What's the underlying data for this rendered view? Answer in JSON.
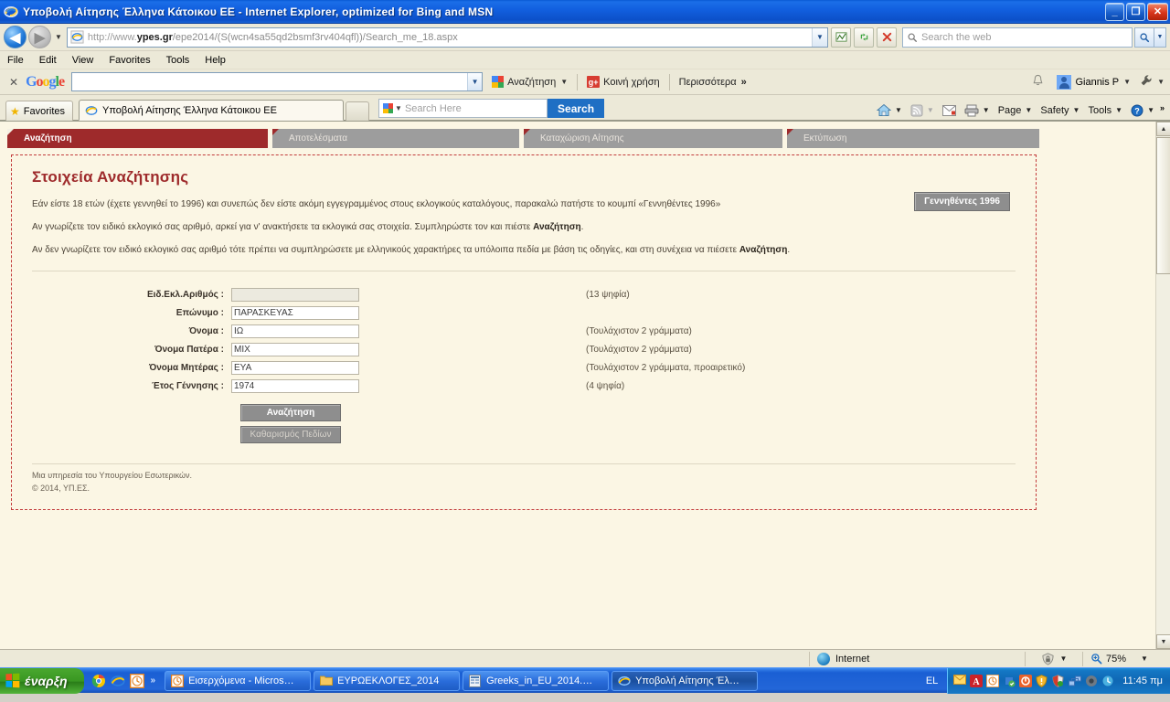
{
  "window": {
    "title": "Υποβολή Αίτησης Έλληνα Κάτοικου ΕΕ - Internet Explorer, optimized for Bing and MSN",
    "minimize_label": "_",
    "restore_label": "❐",
    "close_label": "✕",
    "ie_icon": "internet-explorer-icon"
  },
  "navbar": {
    "back_label": "◀",
    "forward_label": "▶",
    "history_caret": "▼",
    "url_scheme": "http://www.",
    "url_domain": "ypes.gr",
    "url_path": "/epe2014/(S(wcn4sa55qd2bsmf3rv404qfl))/Search_me_18.aspx",
    "address_caret": "▼",
    "compat_icon": "compatibility-view-icon",
    "refresh_icon": "refresh-icon",
    "stop_icon": "stop-icon",
    "search_placeholder": "Search the web",
    "search_icon": "search-icon",
    "search_caret": "▼"
  },
  "menubar": {
    "items": [
      "File",
      "Edit",
      "View",
      "Favorites",
      "Tools",
      "Help"
    ]
  },
  "google_toolbar": {
    "close_label": "✕",
    "logo": [
      "G",
      "o",
      "o",
      "g",
      "l",
      "e"
    ],
    "input_value": "",
    "input_caret": "▼",
    "search_label": "Αναζήτηση",
    "search_caret": "▼",
    "share_label": "Κοινή χρήση",
    "share_icon": "google-plus-icon",
    "more_label": "Περισσότερα",
    "more_chevron": "»",
    "bell_icon": "notifications-bell-icon",
    "account_name": "Giannis P",
    "account_caret": "▼",
    "wrench_icon": "wrench-settings-icon",
    "wrench_caret": "▼"
  },
  "favbar": {
    "favorites_label": "Favorites",
    "star_icon": "star-icon",
    "tab_title": "Υποβολή Αίτησης Έλληνα Κάτοικου ΕΕ",
    "new_tab_label": "",
    "bing_placeholder": "Search Here",
    "bing_caret": "▼",
    "bing_button": "Search",
    "commands": [
      {
        "label": "",
        "icon": "home-icon",
        "caret": "▼"
      },
      {
        "label": "",
        "icon": "rss-feed-icon",
        "caret": "▼"
      },
      {
        "label": "",
        "icon": "mail-icon",
        "caret": ""
      },
      {
        "label": "",
        "icon": "print-icon",
        "caret": "▼"
      },
      {
        "label": "Page",
        "icon": "",
        "caret": "▼"
      },
      {
        "label": "Safety",
        "icon": "",
        "caret": "▼"
      },
      {
        "label": "Tools",
        "icon": "",
        "caret": "▼"
      },
      {
        "label": "",
        "icon": "help-icon",
        "caret": "▼"
      }
    ],
    "overflow_chevron": "»"
  },
  "app": {
    "tabs": [
      {
        "label": "Αναζήτηση",
        "active": true
      },
      {
        "label": "Αποτελέσματα",
        "active": false
      },
      {
        "label": "Καταχώριση Αίτησης",
        "active": false
      },
      {
        "label": "Εκτύπωση",
        "active": false
      }
    ],
    "page_title": "Στοιχεία Αναζήτησης",
    "intro": {
      "p1": "Εάν είστε 18 ετών (έχετε γεννηθεί το 1996) και συνεπώς δεν είστε ακόμη εγγεγραμμένος στους εκλογικούς καταλόγους, παρακαλώ πατήστε το κουμπί «Γεννηθέντες 1996»",
      "p2_a": "Αν γνωρίζετε τον ειδικό εκλογικό σας αριθμό, αρκεί για ν' ανακτήσετε τα εκλογικά σας στοιχεία. Συμπληρώστε τον και πιέστε ",
      "p2_b": "Αναζήτηση",
      "p2_c": ".",
      "p3_a": "Αν δεν γνωρίζετε τον ειδικό εκλογικό σας αριθμό τότε πρέπει να συμπληρώσετε με ελληνικούς χαρακτήρες τα υπόλοιπα πεδία με βάση τις οδηγίες, και στη συνέχεια να πιέσετε ",
      "p3_b": "Αναζήτηση",
      "p3_c": "."
    },
    "born1996_button": "Γεννηθέντες 1996",
    "fields": [
      {
        "label": "Ειδ.Εκλ.Αριθμός :",
        "value": "",
        "hint": "(13 ψηφία)",
        "empty": true
      },
      {
        "label": "Επώνυμο :",
        "value": "ΠΑΡΑΣΚΕΥΑΣ",
        "hint": "",
        "empty": false
      },
      {
        "label": "Όνομα :",
        "value": "ΙΩ",
        "hint": "(Τουλάχιστον 2 γράμματα)",
        "empty": false
      },
      {
        "label": "Όνομα Πατέρα :",
        "value": "ΜΙΧ",
        "hint": "(Τουλάχιστον 2 γράμματα)",
        "empty": false
      },
      {
        "label": "Όνομα Μητέρας :",
        "value": "ΕΥΑ",
        "hint": "(Τουλάχιστον 2 γράμματα, προαιρετικό)",
        "empty": false
      },
      {
        "label": "Έτος Γέννησης :",
        "value": "1974",
        "hint": "(4 ψηφία)",
        "empty": false
      }
    ],
    "search_button": "Αναζήτηση",
    "clear_button": "Καθαρισμός Πεδίων",
    "footer_line1": "Μια υπηρεσία του Υπουργείου Εσωτερικών.",
    "footer_line2": "© 2014, ΥΠ.ΕΣ."
  },
  "statusbar": {
    "zone_label": "Internet",
    "zone_icon": "internet-zone-globe-icon",
    "protected_icon": "protected-mode-icon",
    "protected_caret": "▼",
    "zoom_icon": "zoom-icon",
    "zoom_level": "75%",
    "zoom_caret": "▼"
  },
  "taskbar": {
    "start_label": "έναρξη",
    "quicklaunch": [
      {
        "icon": "chrome-icon"
      },
      {
        "icon": "internet-explorer-icon"
      },
      {
        "icon": "clock-icon"
      }
    ],
    "quicklaunch_more": "»",
    "items": [
      {
        "label": "Εισερχόμενα - Micros…",
        "icon": "outlook-icon",
        "active": false
      },
      {
        "label": "ΕΥΡΩΕΚΛΟΓΕΣ_2014",
        "icon": "folder-icon",
        "active": false
      },
      {
        "label": "Greeks_in_EU_2014.…",
        "icon": "excel-icon",
        "active": false
      },
      {
        "label": "Υποβολή Αίτησης Έλ…",
        "icon": "internet-explorer-icon",
        "active": true
      }
    ],
    "language": "EL",
    "tray_icons": [
      "mail-icon",
      "acrobat-icon",
      "clock-icon",
      "antivirus-icon",
      "avg-icon",
      "shield-icon",
      "security-icon",
      "network-icon",
      "speaker-icon",
      "update-icon"
    ],
    "clock": "11:45 πμ"
  },
  "colors": {
    "accent_red": "#9e2a2b",
    "page_bg": "#fbf6e4",
    "tab_inactive": "#9d9d9d",
    "button_gray": "#8e8e8e"
  }
}
